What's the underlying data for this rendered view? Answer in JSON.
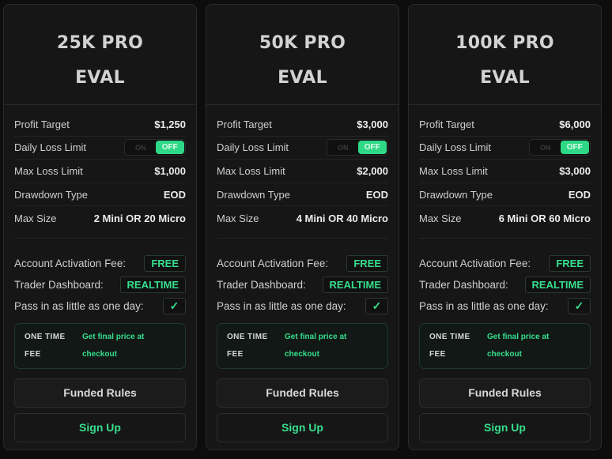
{
  "cards": [
    {
      "title": "25K PRO\nEVAL",
      "specs": {
        "profit_target_label": "Profit Target",
        "profit_target": "$1,250",
        "daily_loss_label": "Daily Loss Limit",
        "toggle_on": "ON",
        "toggle_off": "OFF",
        "max_loss_label": "Max Loss Limit",
        "max_loss": "$1,000",
        "drawdown_label": "Drawdown Type",
        "drawdown": "EOD",
        "max_size_label": "Max Size",
        "max_size": "2 Mini OR 20 Micro"
      },
      "features": {
        "activation_label": "Account Activation Fee:",
        "activation_value": "FREE",
        "dashboard_label": "Trader Dashboard:",
        "dashboard_value": "REALTIME",
        "pass_label": "Pass in as little as one day:",
        "pass_check": "✓"
      },
      "fee": {
        "label": "ONE TIME FEE",
        "value": "Get final price at checkout"
      },
      "buttons": {
        "rules": "Funded Rules",
        "signup": "Sign Up"
      }
    },
    {
      "title": "50K PRO\nEVAL",
      "specs": {
        "profit_target_label": "Profit Target",
        "profit_target": "$3,000",
        "daily_loss_label": "Daily Loss Limit",
        "toggle_on": "ON",
        "toggle_off": "OFF",
        "max_loss_label": "Max Loss Limit",
        "max_loss": "$2,000",
        "drawdown_label": "Drawdown Type",
        "drawdown": "EOD",
        "max_size_label": "Max Size",
        "max_size": "4 Mini OR 40 Micro"
      },
      "features": {
        "activation_label": "Account Activation Fee:",
        "activation_value": "FREE",
        "dashboard_label": "Trader Dashboard:",
        "dashboard_value": "REALTIME",
        "pass_label": "Pass in as little as one day:",
        "pass_check": "✓"
      },
      "fee": {
        "label": "ONE TIME FEE",
        "value": "Get final price at checkout"
      },
      "buttons": {
        "rules": "Funded Rules",
        "signup": "Sign Up"
      }
    },
    {
      "title": "100K PRO\nEVAL",
      "specs": {
        "profit_target_label": "Profit Target",
        "profit_target": "$6,000",
        "daily_loss_label": "Daily Loss Limit",
        "toggle_on": "ON",
        "toggle_off": "OFF",
        "max_loss_label": "Max Loss Limit",
        "max_loss": "$3,000",
        "drawdown_label": "Drawdown Type",
        "drawdown": "EOD",
        "max_size_label": "Max Size",
        "max_size": "6 Mini OR 60 Micro"
      },
      "features": {
        "activation_label": "Account Activation Fee:",
        "activation_value": "FREE",
        "dashboard_label": "Trader Dashboard:",
        "dashboard_value": "REALTIME",
        "pass_label": "Pass in as little as one day:",
        "pass_check": "✓"
      },
      "fee": {
        "label": "ONE TIME FEE",
        "value": "Get final price at checkout"
      },
      "buttons": {
        "rules": "Funded Rules",
        "signup": "Sign Up"
      }
    }
  ],
  "colors": {
    "accent": "#37df8d",
    "toggle_active": "#2fd886",
    "card_bg": "#161616",
    "page_bg": "#0d0d0d"
  }
}
